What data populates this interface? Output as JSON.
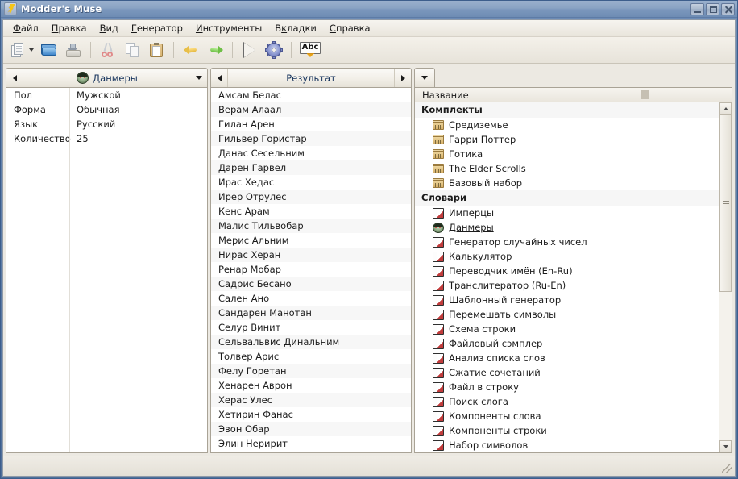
{
  "window": {
    "title": "Modder's Muse",
    "icon": "lightning-bolt-icon",
    "buttons": {
      "minimize": "minimize-icon",
      "maximize": "maximize-icon",
      "close": "close-icon"
    }
  },
  "menu": [
    {
      "label": "Файл",
      "accel": "Ф"
    },
    {
      "label": "Правка",
      "accel": "П"
    },
    {
      "label": "Вид",
      "accel": "В"
    },
    {
      "label": "Генератор",
      "accel": "Г"
    },
    {
      "label": "Инструменты",
      "accel": "И"
    },
    {
      "label": "Вкладки",
      "accel": "к"
    },
    {
      "label": "Справка",
      "accel": "С"
    }
  ],
  "toolbar": [
    {
      "name": "new-document-button",
      "icon": "new-document-icon"
    },
    {
      "name": "new-document-dropdown",
      "icon": "chevron-down-icon"
    },
    {
      "name": "open-button",
      "icon": "open-folder-icon"
    },
    {
      "name": "save-button",
      "icon": "save-icon"
    },
    {
      "name": "cut-button",
      "icon": "scissors-icon"
    },
    {
      "name": "copy-button",
      "icon": "copy-icon"
    },
    {
      "name": "paste-button",
      "icon": "clipboard-paste-icon"
    },
    {
      "name": "undo-button",
      "icon": "undo-arrow-icon"
    },
    {
      "name": "redo-button",
      "icon": "redo-arrow-icon"
    },
    {
      "name": "run-button",
      "icon": "play-triangle-icon"
    },
    {
      "name": "settings-button",
      "icon": "gear-icon"
    },
    {
      "name": "spellcheck-button",
      "icon": "abc-spellcheck-icon"
    }
  ],
  "left_panel": {
    "tab_title": "Данмеры",
    "tab_icon": "dunmer-face-icon",
    "prev_icon": "triangle-left-icon",
    "menu_icon": "triangle-down-icon",
    "params": [
      {
        "key": "Пол",
        "value": "Мужской"
      },
      {
        "key": "Форма",
        "value": "Обычная"
      },
      {
        "key": "Язык",
        "value": "Русский"
      },
      {
        "key": "Количество",
        "value": "25"
      }
    ]
  },
  "middle_panel": {
    "tab_title": "Результат",
    "prev_icon": "triangle-left-icon",
    "next_icon": "triangle-right-icon",
    "results": [
      "Амсам Белас",
      "Верам Алаал",
      "Гилан Арен",
      "Гильвер Гористар",
      "Данас Сесельним",
      "Дарен Гарвел",
      "Ирас Хедас",
      "Ирер Отрулес",
      "Кенс Арам",
      "Малис Тильвобар",
      "Мерис Альним",
      "Нирас Херан",
      "Ренар Мобар",
      "Садрис Бесано",
      "Сален Ано",
      "Сандарен Манотан",
      "Селур Винит",
      "Сельвальвис Динальним",
      "Толвер Арис",
      "Фелу Горетан",
      "Хенарен Аврон",
      "Херас Улес",
      "Хетирин Фанас",
      "Эвон Обар",
      "Элин Неририт"
    ]
  },
  "right_panel": {
    "tab_menu_icon": "triangle-down-icon",
    "column_header": "Название",
    "groups": [
      {
        "title": "Комплекты",
        "items": [
          {
            "label": "Средиземье",
            "icon": "crate-icon",
            "link": false
          },
          {
            "label": "Гарри Поттер",
            "icon": "crate-icon",
            "link": false
          },
          {
            "label": "Готика",
            "icon": "crate-icon",
            "link": false
          },
          {
            "label": "The Elder Scrolls",
            "icon": "crate-icon",
            "link": false
          },
          {
            "label": "Базовый набор",
            "icon": "crate-icon",
            "link": false
          }
        ]
      },
      {
        "title": "Словари",
        "items": [
          {
            "label": "Имперцы",
            "icon": "book-icon",
            "link": false
          },
          {
            "label": "Данмеры",
            "icon": "dunmer-face-icon",
            "link": true
          },
          {
            "label": "Генератор случайных чисел",
            "icon": "book-icon",
            "link": false
          },
          {
            "label": "Калькулятор",
            "icon": "book-icon",
            "link": false
          },
          {
            "label": "Переводчик имён (En-Ru)",
            "icon": "book-icon",
            "link": false
          },
          {
            "label": "Транслитератор (Ru-En)",
            "icon": "book-icon",
            "link": false
          },
          {
            "label": "Шаблонный генератор",
            "icon": "book-icon",
            "link": false
          },
          {
            "label": "Перемешать символы",
            "icon": "book-icon",
            "link": false
          },
          {
            "label": "Схема строки",
            "icon": "book-icon",
            "link": false
          },
          {
            "label": "Файловый сэмплер",
            "icon": "book-icon",
            "link": false
          },
          {
            "label": "Анализ списка слов",
            "icon": "book-icon",
            "link": false
          },
          {
            "label": "Сжатие сочетаний",
            "icon": "book-icon",
            "link": false
          },
          {
            "label": "Файл в строку",
            "icon": "book-icon",
            "link": false
          },
          {
            "label": "Поиск слога",
            "icon": "book-icon",
            "link": false
          },
          {
            "label": "Компоненты слова",
            "icon": "book-icon",
            "link": false
          },
          {
            "label": "Компоненты строки",
            "icon": "book-icon",
            "link": false
          },
          {
            "label": "Набор символов",
            "icon": "book-icon",
            "link": false
          }
        ]
      }
    ],
    "scrollbar": {
      "up_icon": "triangle-up-icon",
      "down_icon": "triangle-down-icon"
    }
  },
  "statusbar": {
    "text": "",
    "grip_icon": "resize-grip-icon"
  },
  "colors": {
    "titlebar": "#7b97bd",
    "window_border": "#3d5e8c",
    "client_bg": "#ece9e2",
    "panel_bg": "#ffffff",
    "text": "#1b1b1b",
    "tab_title": "#16335c"
  }
}
